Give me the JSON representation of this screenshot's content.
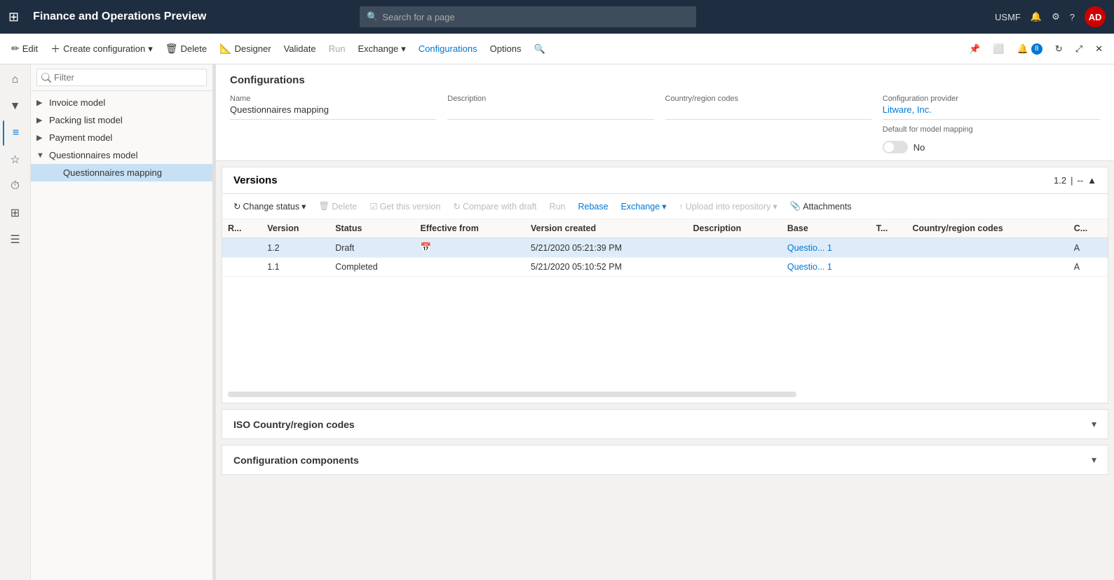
{
  "app": {
    "title": "Finance and Operations Preview",
    "search_placeholder": "Search for a page",
    "user": "USMF",
    "avatar": "AD"
  },
  "command_bar": {
    "edit": "Edit",
    "create_config": "Create configuration",
    "delete": "Delete",
    "designer": "Designer",
    "validate": "Validate",
    "run": "Run",
    "exchange": "Exchange",
    "configurations": "Configurations",
    "options": "Options"
  },
  "tree": {
    "filter_placeholder": "Filter",
    "items": [
      {
        "label": "Invoice model",
        "indent": 0,
        "has_children": true,
        "expanded": false
      },
      {
        "label": "Packing list model",
        "indent": 0,
        "has_children": true,
        "expanded": false
      },
      {
        "label": "Payment model",
        "indent": 0,
        "has_children": true,
        "expanded": false
      },
      {
        "label": "Questionnaires model",
        "indent": 0,
        "has_children": true,
        "expanded": true
      },
      {
        "label": "Questionnaires mapping",
        "indent": 1,
        "has_children": false,
        "expanded": false,
        "selected": true
      }
    ]
  },
  "content": {
    "section_title": "Configurations",
    "fields": {
      "name_label": "Name",
      "name_value": "Questionnaires mapping",
      "description_label": "Description",
      "description_value": "",
      "country_label": "Country/region codes",
      "country_value": "",
      "provider_label": "Configuration provider",
      "provider_value": "Litware, Inc.",
      "default_mapping_label": "Default for model mapping",
      "default_mapping_value": "No",
      "default_mapping_toggle": false
    }
  },
  "versions": {
    "title": "Versions",
    "version_indicator": "1.2",
    "toolbar": {
      "change_status": "Change status",
      "delete": "Delete",
      "get_this_version": "Get this version",
      "compare_with_draft": "Compare with draft",
      "run": "Run",
      "rebase": "Rebase",
      "exchange": "Exchange",
      "upload_into_repository": "Upload into repository",
      "attachments": "Attachments"
    },
    "columns": [
      "R...",
      "Version",
      "Status",
      "Effective from",
      "Version created",
      "Description",
      "Base",
      "T...",
      "Country/region codes",
      "C..."
    ],
    "rows": [
      {
        "r": "",
        "version": "1.2",
        "status": "Draft",
        "effective_from": "",
        "version_created": "5/21/2020 05:21:39 PM",
        "description": "",
        "base": "Questio...",
        "base_link": "1",
        "t": "",
        "country": "",
        "c": "A",
        "selected": true
      },
      {
        "r": "",
        "version": "1.1",
        "status": "Completed",
        "effective_from": "",
        "version_created": "5/21/2020 05:10:52 PM",
        "description": "",
        "base": "Questio...",
        "base_link": "1",
        "t": "",
        "country": "",
        "c": "A",
        "selected": false
      }
    ]
  },
  "iso_section": {
    "title": "ISO Country/region codes"
  },
  "config_components": {
    "title": "Configuration components"
  }
}
